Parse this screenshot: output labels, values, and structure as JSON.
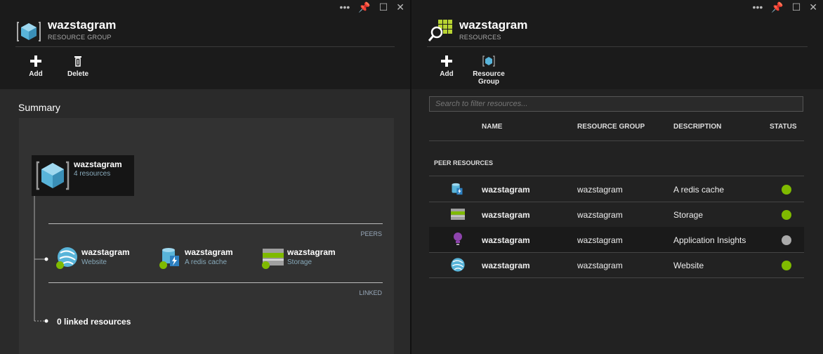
{
  "left": {
    "title": "wazstagram",
    "subtitle": "RESOURCE GROUP",
    "commands": {
      "add": "Add",
      "delete": "Delete"
    },
    "summary_label": "Summary",
    "group_tile": {
      "name": "wazstagram",
      "count": "4 resources"
    },
    "peers_label": "PEERS",
    "linked_label": "LINKED",
    "peers": [
      {
        "name": "wazstagram",
        "type": "Website",
        "icon": "website-icon"
      },
      {
        "name": "wazstagram",
        "type": "A redis cache",
        "icon": "redis-cache-icon"
      },
      {
        "name": "wazstagram",
        "type": "Storage",
        "icon": "storage-icon"
      }
    ],
    "linked_text": "0 linked resources"
  },
  "right": {
    "title": "wazstagram",
    "subtitle": "RESOURCES",
    "commands": {
      "add": "Add",
      "resource_group_line1": "Resource",
      "resource_group_line2": "Group"
    },
    "filter_placeholder": "Search to filter resources...",
    "columns": {
      "name": "NAME",
      "group": "RESOURCE GROUP",
      "description": "DESCRIPTION",
      "status": "STATUS"
    },
    "section_label": "PEER RESOURCES",
    "rows": [
      {
        "name": "wazstagram",
        "group": "wazstagram",
        "description": "A redis cache",
        "status": "ok",
        "icon": "redis-cache-icon"
      },
      {
        "name": "wazstagram",
        "group": "wazstagram",
        "description": "Storage",
        "status": "ok",
        "icon": "storage-icon"
      },
      {
        "name": "wazstagram",
        "group": "wazstagram",
        "description": "Application Insights",
        "status": "unknown",
        "icon": "lightbulb-icon"
      },
      {
        "name": "wazstagram",
        "group": "wazstagram",
        "description": "Website",
        "status": "ok",
        "icon": "website-icon"
      }
    ]
  },
  "colors": {
    "accent_green": "#7fba00",
    "cube_blue": "#59b4d9",
    "status_gray": "#aaaaaa"
  }
}
